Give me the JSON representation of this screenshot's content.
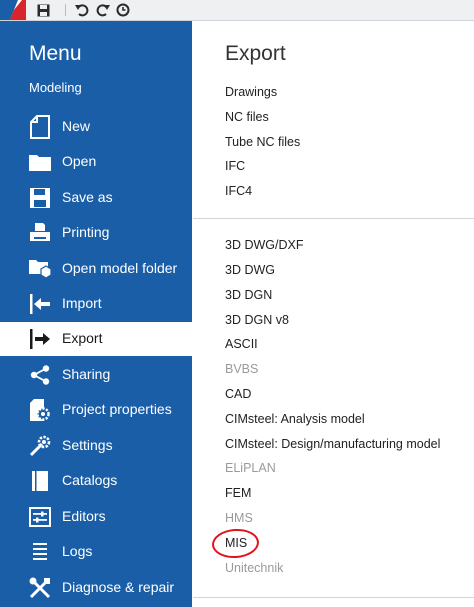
{
  "sidebar": {
    "title": "Menu",
    "subtitle": "Modeling",
    "items": [
      {
        "label": "New"
      },
      {
        "label": "Open"
      },
      {
        "label": "Save as"
      },
      {
        "label": "Printing"
      },
      {
        "label": "Open model folder"
      },
      {
        "label": "Import"
      },
      {
        "label": "Export"
      },
      {
        "label": "Sharing"
      },
      {
        "label": "Project properties"
      },
      {
        "label": "Settings"
      },
      {
        "label": "Catalogs"
      },
      {
        "label": "Editors"
      },
      {
        "label": "Logs"
      },
      {
        "label": "Diagnose & repair"
      }
    ],
    "active_item": "Export"
  },
  "content": {
    "title": "Export",
    "group1": [
      {
        "label": "Drawings"
      },
      {
        "label": "NC files"
      },
      {
        "label": "Tube NC files"
      },
      {
        "label": "IFC"
      },
      {
        "label": "IFC4"
      }
    ],
    "group2": [
      {
        "label": "3D DWG/DXF",
        "enabled": true
      },
      {
        "label": "3D DWG",
        "enabled": true
      },
      {
        "label": "3D DGN",
        "enabled": true
      },
      {
        "label": "3D DGN v8",
        "enabled": true
      },
      {
        "label": "ASCII",
        "enabled": true
      },
      {
        "label": "BVBS",
        "enabled": false
      },
      {
        "label": "CAD",
        "enabled": true
      },
      {
        "label": "CIMsteel: Analysis model",
        "enabled": true
      },
      {
        "label": "CIMsteel: Design/manufacturing model",
        "enabled": true
      },
      {
        "label": "ELiPLAN",
        "enabled": false
      },
      {
        "label": "FEM",
        "enabled": true
      },
      {
        "label": "HMS",
        "enabled": false
      },
      {
        "label": "MIS",
        "enabled": true
      },
      {
        "label": "Unitechnik",
        "enabled": false
      }
    ]
  },
  "colors": {
    "sidebar_bg": "#1b5ea8",
    "annotation_circle": "#e0151b",
    "disabled_text": "#9a9a9a"
  }
}
